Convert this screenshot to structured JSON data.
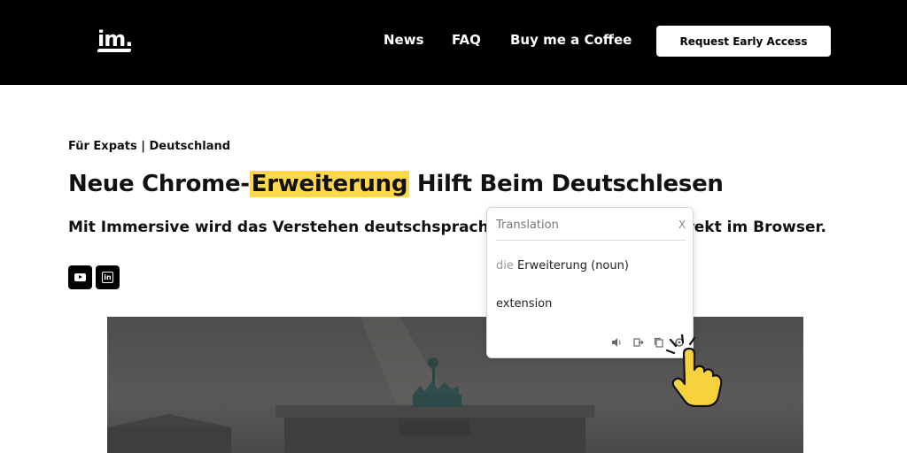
{
  "header": {
    "logo": "im.",
    "nav": [
      "News",
      "FAQ",
      "Buy me a Coffee"
    ],
    "cta_label": "Request Early Access"
  },
  "article": {
    "kicker": "Für Expats | Deutschland",
    "title_before": "Neue Chrome-",
    "title_highlight": "Erweiterung",
    "title_after": " Hilft Beim Deutschlesen",
    "subtitle": "Mit Immersive wird das Verstehen deutschsprachi",
    "subtitle_tail": "irekt im Browser."
  },
  "social": {
    "icons": [
      "youtube-icon",
      "linkedin-icon"
    ]
  },
  "popup": {
    "title": "Translation",
    "close": "X",
    "article": "die",
    "word": "Erweiterung (noun)",
    "translation": "extension",
    "tools": [
      "speaker-icon",
      "export-icon",
      "copy-icon",
      "settings-icon"
    ]
  },
  "colors": {
    "header_bg": "#000000",
    "highlight": "#ffd84d",
    "hand": "#f6d23c"
  }
}
